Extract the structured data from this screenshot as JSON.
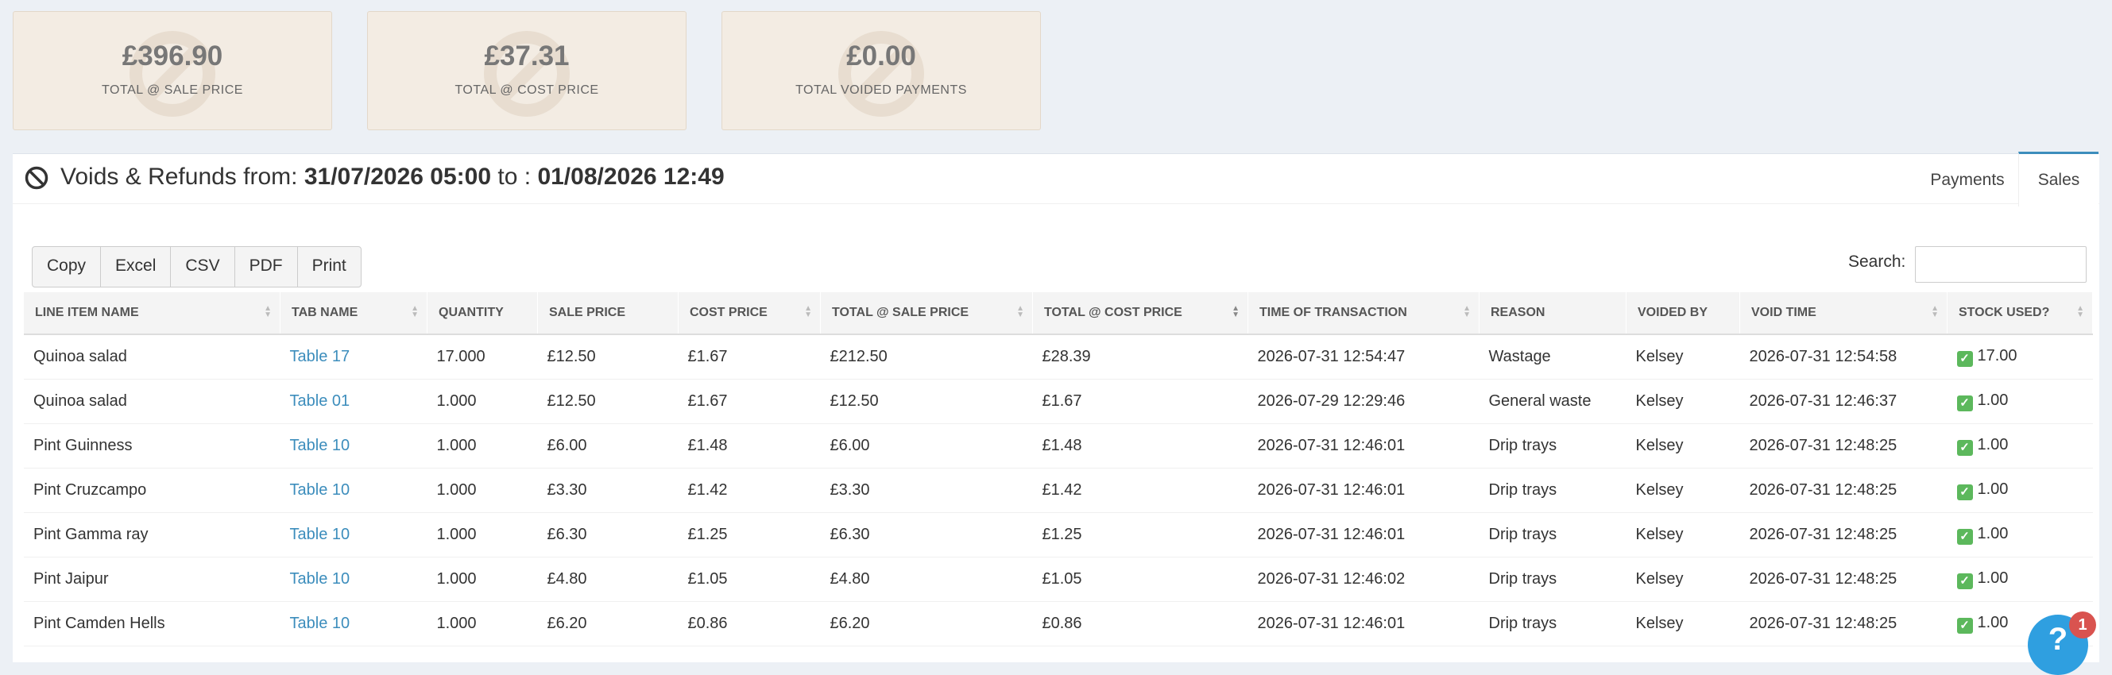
{
  "stats": [
    {
      "value": "£396.90",
      "label": "TOTAL @ SALE PRICE"
    },
    {
      "value": "£37.31",
      "label": "TOTAL @ COST PRICE"
    },
    {
      "value": "£0.00",
      "label": "TOTAL VOIDED PAYMENTS"
    }
  ],
  "panel": {
    "title_prefix": "Voids & Refunds from:",
    "from": "31/07/2026 05:00",
    "to_label": "to :",
    "to": "01/08/2026 12:49",
    "tabs": [
      {
        "label": "Payments",
        "active": false
      },
      {
        "label": "Sales",
        "active": true
      }
    ]
  },
  "toolbar": {
    "buttons": [
      "Copy",
      "Excel",
      "CSV",
      "PDF",
      "Print"
    ],
    "search_label": "Search:",
    "search_value": ""
  },
  "table": {
    "columns": [
      "LINE ITEM NAME",
      "TAB NAME",
      "QUANTITY",
      "SALE PRICE",
      "COST PRICE",
      "TOTAL @ SALE PRICE",
      "TOTAL @ COST PRICE",
      "TIME OF TRANSACTION",
      "REASON",
      "VOIDED BY",
      "VOID TIME",
      "STOCK USED?"
    ],
    "rows": [
      [
        "Quinoa salad",
        "Table 17",
        "17.000",
        "£12.50",
        "£1.67",
        "£212.50",
        "£28.39",
        "2026-07-31 12:54:47",
        "Wastage",
        "Kelsey",
        "2026-07-31 12:54:58",
        "17.00"
      ],
      [
        "Quinoa salad",
        "Table 01",
        "1.000",
        "£12.50",
        "£1.67",
        "£12.50",
        "£1.67",
        "2026-07-29 12:29:46",
        "General waste",
        "Kelsey",
        "2026-07-31 12:46:37",
        "1.00"
      ],
      [
        "Pint Guinness",
        "Table 10",
        "1.000",
        "£6.00",
        "£1.48",
        "£6.00",
        "£1.48",
        "2026-07-31 12:46:01",
        "Drip trays",
        "Kelsey",
        "2026-07-31 12:48:25",
        "1.00"
      ],
      [
        "Pint Cruzcampo",
        "Table 10",
        "1.000",
        "£3.30",
        "£1.42",
        "£3.30",
        "£1.42",
        "2026-07-31 12:46:01",
        "Drip trays",
        "Kelsey",
        "2026-07-31 12:48:25",
        "1.00"
      ],
      [
        "Pint Gamma ray",
        "Table 10",
        "1.000",
        "£6.30",
        "£1.25",
        "£6.30",
        "£1.25",
        "2026-07-31 12:46:01",
        "Drip trays",
        "Kelsey",
        "2026-07-31 12:48:25",
        "1.00"
      ],
      [
        "Pint Jaipur",
        "Table 10",
        "1.000",
        "£4.80",
        "£1.05",
        "£4.80",
        "£1.05",
        "2026-07-31 12:46:02",
        "Drip trays",
        "Kelsey",
        "2026-07-31 12:48:25",
        "1.00"
      ],
      [
        "Pint Camden Hells",
        "Table 10",
        "1.000",
        "£6.20",
        "£0.86",
        "£6.20",
        "£0.86",
        "2026-07-31 12:46:01",
        "Drip trays",
        "Kelsey",
        "2026-07-31 12:48:25",
        "1.00"
      ]
    ]
  },
  "help": {
    "icon": "help-icon",
    "badge_count": "1"
  },
  "colors": {
    "accent": "#3c8dbc",
    "stat_bg": "#f3ece3",
    "check": "#5cb85c",
    "badge": "#d9534f"
  }
}
